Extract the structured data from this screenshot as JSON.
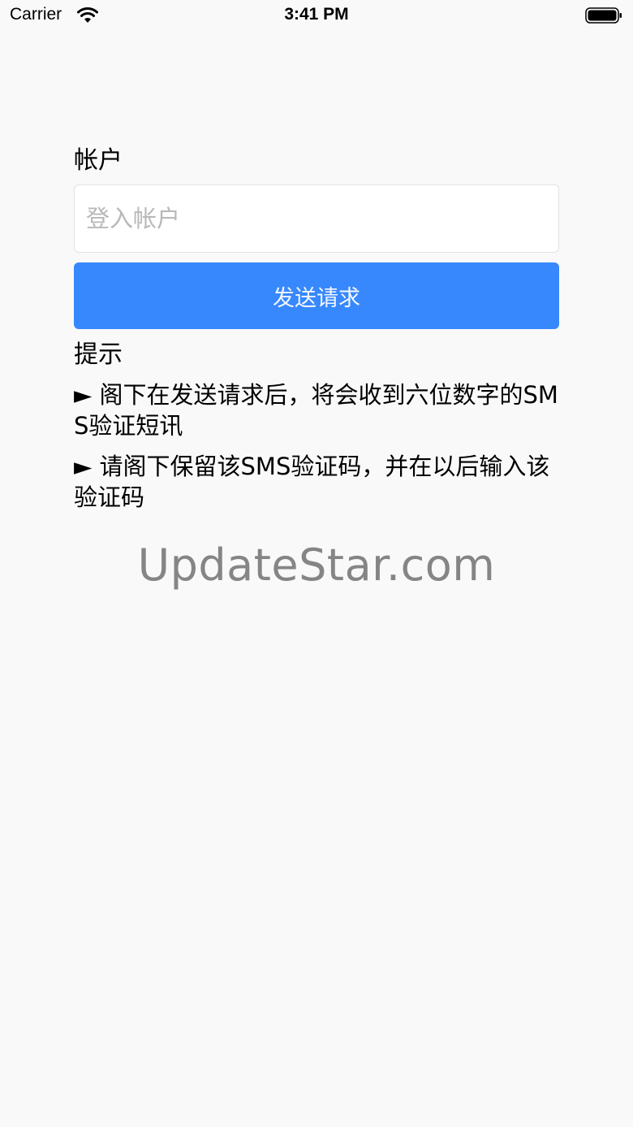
{
  "status_bar": {
    "carrier": "Carrier",
    "time": "3:41 PM",
    "icons": [
      "wifi-icon",
      "battery-icon"
    ]
  },
  "form": {
    "account_label": "帐户",
    "account_input": {
      "value": "",
      "placeholder": "登入帐户"
    },
    "send_button_label": "发送请求"
  },
  "hints": {
    "title": "提示",
    "items": [
      "► 阁下在发送请求后，将会收到六位数字的SMS验证短讯",
      "► 请阁下保留该SMS验证码，并在以后输入该验证码"
    ]
  },
  "watermark": "UpdateStar.com",
  "colors": {
    "background": "#f9f9f9",
    "button": "#3788fc",
    "button_text": "#f3f7ff",
    "watermark": "#858585"
  }
}
